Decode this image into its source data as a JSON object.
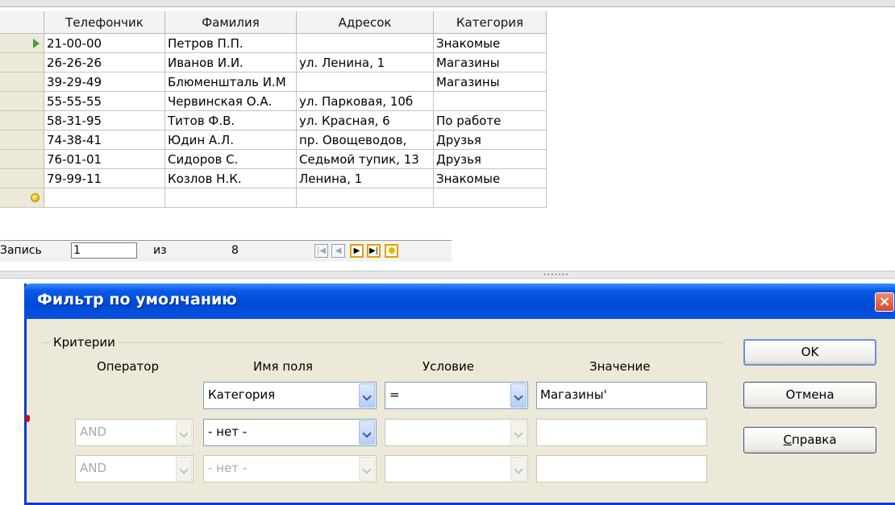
{
  "grid": {
    "columns": [
      "Телефончик",
      "Фамилия",
      "Адресок",
      "Категория"
    ],
    "rows": [
      {
        "phone": "21-00-00",
        "name": "Петров П.П.",
        "address": "",
        "category": "Знакомые",
        "current": true
      },
      {
        "phone": "26-26-26",
        "name": "Иванов И.И.",
        "address": "ул. Ленина, 1",
        "category": "Магазины"
      },
      {
        "phone": "39-29-49",
        "name": "Блюменшталь И.М",
        "address": "",
        "category": "Магазины"
      },
      {
        "phone": "55-55-55",
        "name": "Червинская О.А.",
        "address": "ул. Парковая, 10б",
        "category": ""
      },
      {
        "phone": "58-31-95",
        "name": "Титов Ф.В.",
        "address": "ул. Красная, 6",
        "category": "По работе"
      },
      {
        "phone": "74-38-41",
        "name": "Юдин А.Л.",
        "address": "пр. Овощеводов,",
        "category": "Друзья"
      },
      {
        "phone": "76-01-01",
        "name": "Сидоров С.",
        "address": "Седьмой тупик, 13",
        "category": "Друзья"
      },
      {
        "phone": "79-99-11",
        "name": "Козлов Н.К.",
        "address": "Ленина, 1",
        "category": "Знакомые"
      }
    ]
  },
  "navigation": {
    "record_label": "Запись",
    "record_value": "1",
    "of_label": "из",
    "total": "8",
    "buttons": [
      "first",
      "previous",
      "next",
      "last",
      "new"
    ]
  },
  "dialog": {
    "title": "Фильтр по умолчанию",
    "group_label": "Критерии",
    "headers": {
      "operator": "Оператор",
      "field_name": "Имя поля",
      "condition": "Условие",
      "value": "Значение"
    },
    "rows": [
      {
        "operator": "",
        "field": "Категория",
        "condition": "=",
        "value": "Магазины'",
        "enabled": true
      },
      {
        "operator": "AND",
        "field": "- нет -",
        "condition": "",
        "value": "",
        "enabled": false
      },
      {
        "operator": "AND",
        "field": "- нет -",
        "condition": "",
        "value": "",
        "enabled": false
      }
    ],
    "buttons": {
      "ok": "OK",
      "cancel": "Отмена",
      "help_first": "С",
      "help_rest": "правка"
    },
    "close_glyph": "×"
  },
  "colors": {
    "title_bar": "#0a5ae8",
    "close_button": "#d8472a",
    "dialog_bg": "#ece9d8",
    "current_row_arrow": "#3aa33a"
  }
}
